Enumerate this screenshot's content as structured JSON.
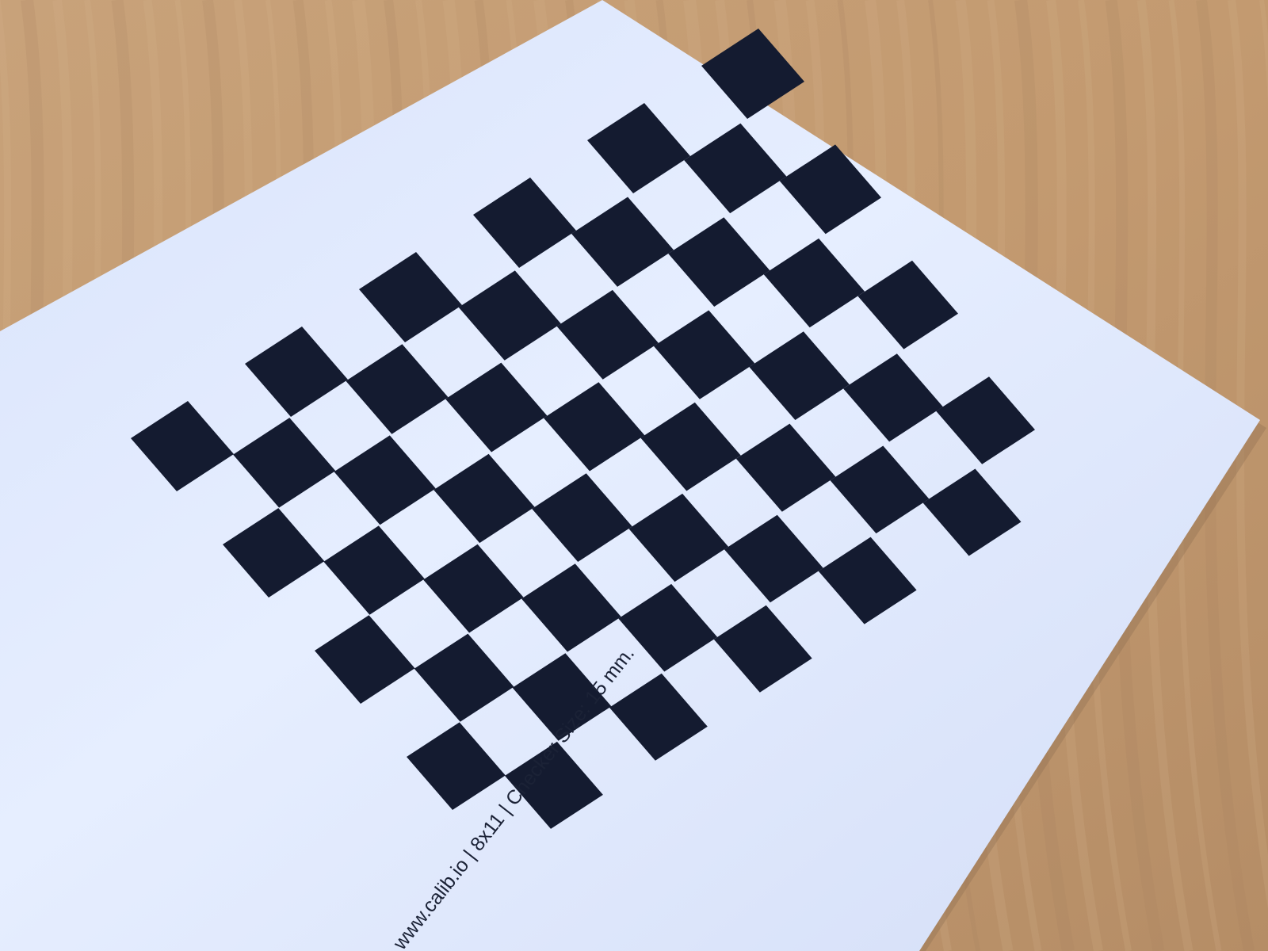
{
  "photo": {
    "subject": "printed checkerboard calibration target on a wooden desk",
    "colors": {
      "desk_base": "#c59d74",
      "desk_dark": "#a8825d",
      "desk_light": "#d8b58f",
      "paper": "#e3ebff",
      "paper_shadow": "#bcc9ea",
      "checker": "#141b30",
      "print_text": "#1b2236"
    }
  },
  "target": {
    "rows": 8,
    "cols": 11,
    "caption": "www.calib.io | 8x11 | Checker Size: 15 mm."
  }
}
